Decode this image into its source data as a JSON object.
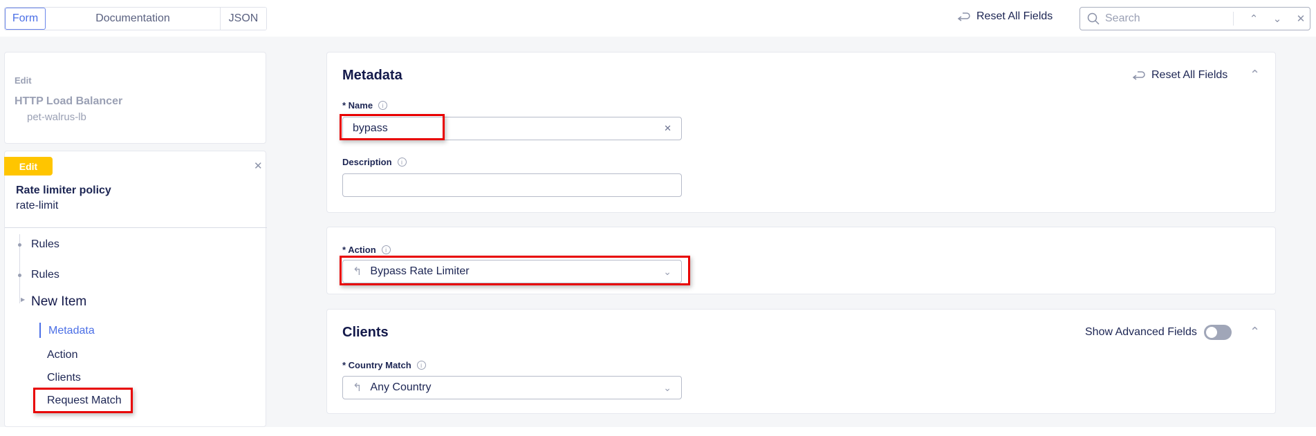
{
  "toolbar": {
    "tabs": [
      "Form",
      "Documentation",
      "JSON"
    ],
    "active_tab": "Form",
    "reset_label": "Reset All Fields",
    "search_placeholder": "Search"
  },
  "sidebar": {
    "parent": {
      "edit_label": "Edit",
      "type": "HTTP Load Balancer",
      "name": "pet-walrus-lb"
    },
    "current": {
      "badge": "Edit",
      "type": "Rate limiter policy",
      "name": "rate-limit"
    },
    "tree": [
      "Rules",
      "Rules",
      "New Item"
    ],
    "sections": [
      "Metadata",
      "Action",
      "Clients",
      "Request Match"
    ],
    "active_section": "Metadata"
  },
  "metadata": {
    "title": "Metadata",
    "reset_label": "Reset All Fields",
    "name_label": "* Name",
    "name_value": "bypass",
    "description_label": "Description",
    "description_value": ""
  },
  "action": {
    "label": "* Action",
    "value": "Bypass Rate Limiter"
  },
  "clients": {
    "title": "Clients",
    "advanced_label": "Show Advanced Fields",
    "advanced_on": false,
    "country_label": "* Country Match",
    "country_value": "Any Country"
  },
  "colors": {
    "accent": "#4b6fe6",
    "badge": "#ffc500",
    "highlight": "#e80000"
  }
}
